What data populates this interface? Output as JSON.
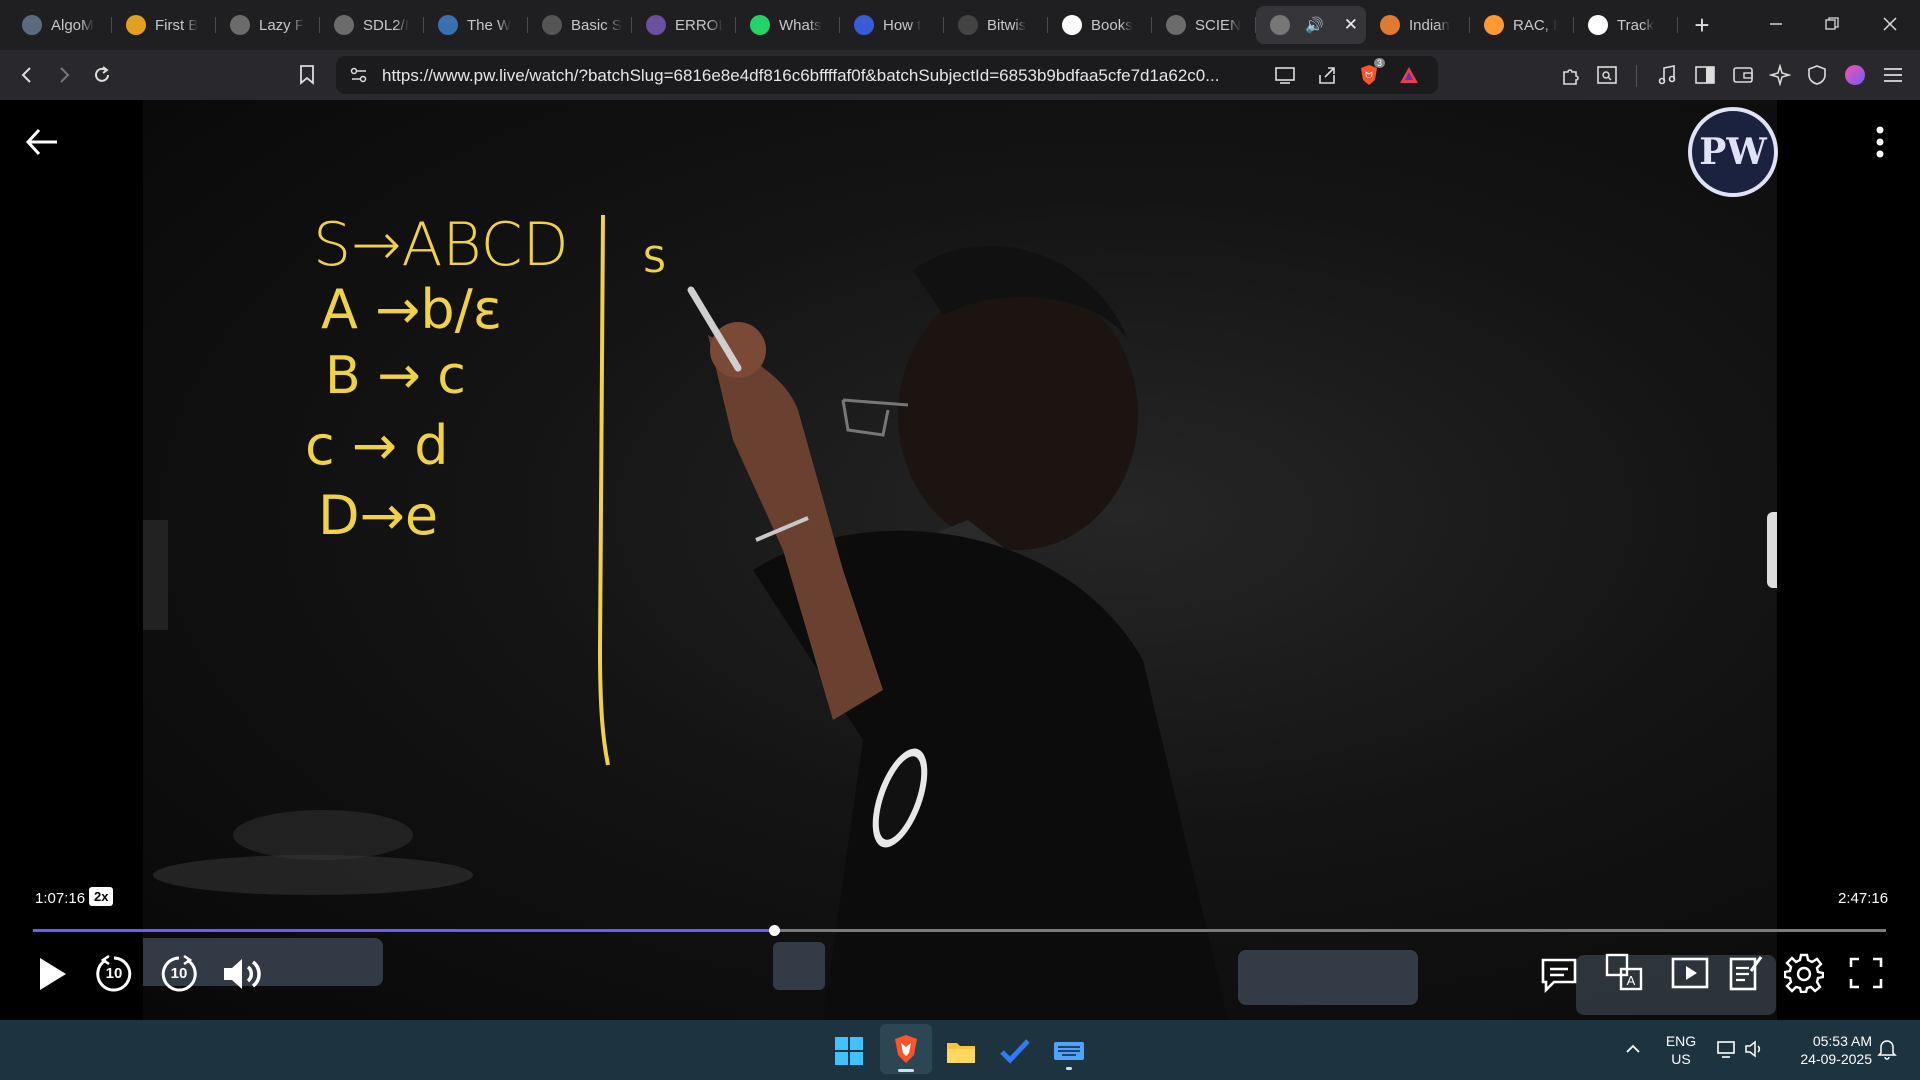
{
  "tabs": [
    {
      "label": "AlgoM",
      "icon": "algomaster-icon",
      "color": "#5b6b7d"
    },
    {
      "label": "First B",
      "icon": "bolt-icon",
      "color": "#e0a020"
    },
    {
      "label": "Lazy F",
      "icon": "globe-icon",
      "color": "#6b6b6b"
    },
    {
      "label": "SDL2/I",
      "icon": "globe-icon",
      "color": "#6b6b6b"
    },
    {
      "label": "The W",
      "icon": "wordpress-icon",
      "color": "#3a6fb0"
    },
    {
      "label": "Basic S",
      "icon": "keyboard-icon",
      "color": "#555"
    },
    {
      "label": "ERROI",
      "icon": "globe-icon",
      "color": "#6c4f9e"
    },
    {
      "label": "Whats",
      "icon": "whatsapp-icon",
      "color": "#25d366"
    },
    {
      "label": "How t",
      "icon": "shield-icon",
      "color": "#3a5bd9"
    },
    {
      "label": "Bitwis",
      "icon": "code-icon",
      "color": "#444"
    },
    {
      "label": "Books",
      "icon": "google-icon",
      "color": "#ffffff"
    },
    {
      "label": "SCIEN",
      "icon": "globe-icon",
      "color": "#6b6b6b"
    },
    {
      "label": "",
      "icon": "pw-icon",
      "color": "#777",
      "active": true
    },
    {
      "label": "Indian",
      "icon": "ball-icon",
      "color": "#e07a30"
    },
    {
      "label": "RAC, I",
      "icon": "india-flag-icon",
      "color": "#ff9933"
    },
    {
      "label": "Track",
      "icon": "amazon-icon",
      "color": "#ffffff"
    }
  ],
  "browser": {
    "url": "https://www.pw.live/watch/?batchSlug=6816e8e4df816c6bffffaf0f&batchSubjectId=6853b9bdfaa5cfe7d1a62c0...",
    "new_tab": "+",
    "shields_count": "3"
  },
  "lecture": {
    "board_lines": [
      "S→ABCD",
      "A →b/ε",
      "B → c",
      "c → d",
      "D→e"
    ],
    "board_right": "S",
    "logo_text": "PW"
  },
  "player": {
    "current_time": "1:07:16",
    "duration": "2:47:16",
    "speed": "2x",
    "progress": 0.4,
    "skip_seconds": "10"
  },
  "taskbar": {
    "lang_top": "ENG",
    "lang_bottom": "US",
    "time": "05:53 AM",
    "date": "24-09-2025"
  },
  "colors": {
    "accent": "#6a5cff",
    "chalk": "#f0d24a",
    "taskbar": "#1d3340"
  }
}
